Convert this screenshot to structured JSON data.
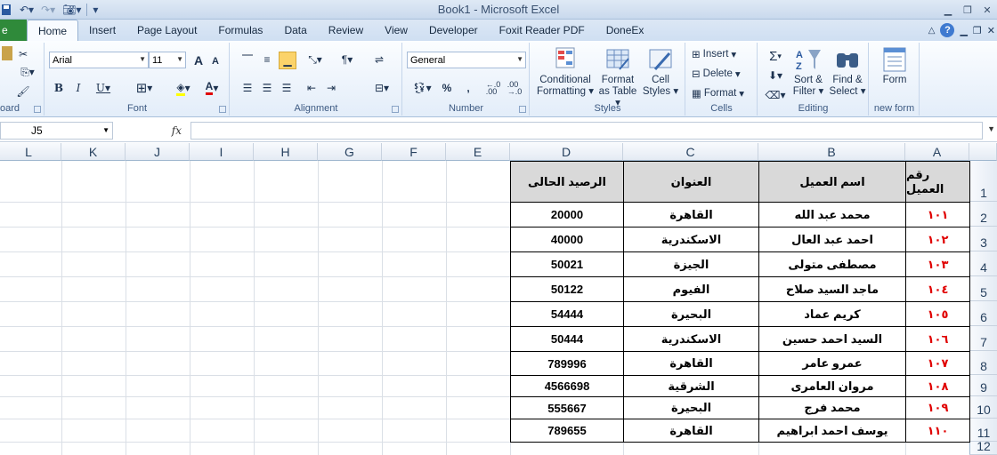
{
  "titlebar": {
    "title": "Book1  -  Microsoft Excel"
  },
  "tabs": [
    "Home",
    "Insert",
    "Page Layout",
    "Formulas",
    "Data",
    "Review",
    "View",
    "Developer",
    "Foxit Reader PDF",
    "DoneEx"
  ],
  "file_tab": "e",
  "ribbon": {
    "clipboard_label": "oard",
    "font_name": "Arial",
    "font_size": "11",
    "font_label": "Font",
    "alignment_label": "Alignment",
    "number_format": "General",
    "number_label": "Number",
    "percent": "%",
    "comma": ",",
    "dec_inc": "←.0\n.00",
    "dec_dec": ".00\n→.0",
    "conditional": "Conditional",
    "formatting": "Formatting",
    "format_as": "Format",
    "as_table": "as Table",
    "cell": "Cell",
    "styles_btn": "Styles",
    "styles_label": "Styles",
    "insert": "Insert",
    "delete": "Delete",
    "format": "Format",
    "cells_label": "Cells",
    "sort": "Sort &",
    "filter": "Filter",
    "find": "Find &",
    "select": "Select",
    "editing_label": "Editing",
    "form": "Form",
    "newform_label": "new form",
    "bold": "B",
    "italic": "I",
    "underline": "U",
    "font_grow": "A",
    "font_shrink": "A",
    "font_color": "A",
    "sigma": "Σ"
  },
  "formula_bar": {
    "name_box": "J5",
    "fx": "fx",
    "formula": ""
  },
  "grid": {
    "columns": [
      "L",
      "K",
      "J",
      "I",
      "H",
      "G",
      "F",
      "E",
      "D",
      "C",
      "B",
      "A"
    ],
    "rows": [
      "1",
      "2",
      "3",
      "4",
      "5",
      "6",
      "7",
      "8",
      "9",
      "10",
      "11",
      "12"
    ],
    "headers": {
      "A": "رقم العميل",
      "B": "اسم العميل",
      "C": "العنوان",
      "D": "الرصيد الحالى"
    },
    "data": [
      {
        "id": "١٠١",
        "name": "محمد عبد الله",
        "address": "القاهرة",
        "balance": "20000"
      },
      {
        "id": "١٠٢",
        "name": "احمد عبد العال",
        "address": "الاسكندرية",
        "balance": "40000"
      },
      {
        "id": "١٠٣",
        "name": "مصطفى متولى",
        "address": "الجيزة",
        "balance": "50021"
      },
      {
        "id": "١٠٤",
        "name": "ماجد السيد صلاح",
        "address": "الفيوم",
        "balance": "50122"
      },
      {
        "id": "١٠٥",
        "name": "كريم عماد",
        "address": "البحيرة",
        "balance": "54444"
      },
      {
        "id": "١٠٦",
        "name": "السيد احمد حسين",
        "address": "الاسكندرية",
        "balance": "50444"
      },
      {
        "id": "١٠٧",
        "name": "عمرو عامر",
        "address": "القاهرة",
        "balance": "789996"
      },
      {
        "id": "١٠٨",
        "name": "مروان العامرى",
        "address": "الشرقية",
        "balance": "4566698"
      },
      {
        "id": "١٠٩",
        "name": "محمد فرج",
        "address": "البحيرة",
        "balance": "555667"
      },
      {
        "id": "١١٠",
        "name": "يوسف احمد ابراهيم",
        "address": "القاهرة",
        "balance": "789655"
      }
    ]
  },
  "colors": {
    "file_tab": "#2f8a3a",
    "id_text": "#e00000",
    "header_fill": "#d9d9d9"
  }
}
